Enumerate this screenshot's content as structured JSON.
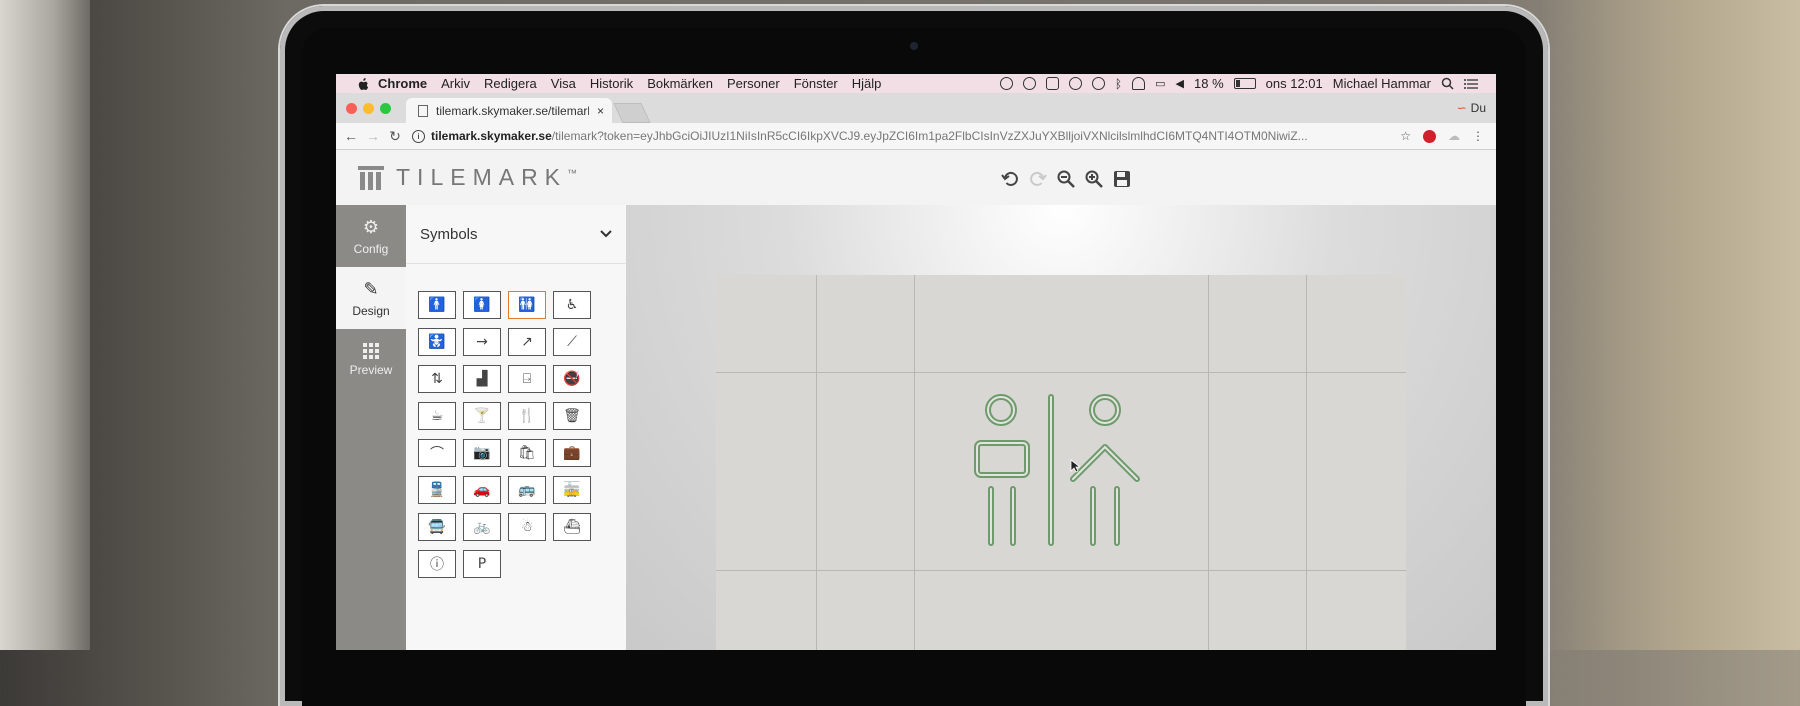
{
  "menubar": {
    "app": "Chrome",
    "items": [
      "Arkiv",
      "Redigera",
      "Visa",
      "Historik",
      "Bokmärken",
      "Personer",
      "Fönster",
      "Hjälp"
    ],
    "battery": "18 %",
    "clock": "ons 12:01",
    "user": "Michael Hammar"
  },
  "browser": {
    "tab_title": "tilemark.skymaker.se/tilemark",
    "tab_close": "×",
    "profile_label": "Du",
    "url_host": "tilemark.skymaker.se",
    "url_path": "/tilemark?token=eyJhbGciOiJIUzI1NiIsInR5cCI6IkpXVCJ9.eyJpZCI6Im1pa2FlbCIsInVzZXJuYXBlljoiVXNlcilslmlhdCI6MTQ4NTI4OTM0NiwiZ..."
  },
  "app": {
    "logo_text": "TILEMARK",
    "logo_tm": "™",
    "sidebar": {
      "tabs": [
        {
          "label": "Config",
          "icon": "gear-icon"
        },
        {
          "label": "Design",
          "icon": "pencil-icon"
        },
        {
          "label": "Preview",
          "icon": "grid-icon"
        }
      ],
      "active": "Design"
    },
    "panel": {
      "title": "Symbols",
      "symbols": [
        "man-icon",
        "woman-icon",
        "toilets-icon",
        "wheelchair-icon",
        "baby-change-icon",
        "arrow-right-icon",
        "arrow-diagonal-icon",
        "escalator-icon",
        "elevator-icon",
        "stairs-icon",
        "exit-icon",
        "no-smoking-icon",
        "coffee-icon",
        "cocktail-icon",
        "restaurant-icon",
        "trash-icon",
        "cloakroom-icon",
        "camera-icon",
        "shopping-icon",
        "luggage-icon",
        "train-icon",
        "car-icon",
        "bus-icon",
        "tram-icon",
        "coach-icon",
        "bicycle-icon",
        "lost-property-icon",
        "boat-icon",
        "info-icon",
        "parking-icon"
      ],
      "selected_index": 2
    },
    "toolbar": [
      "undo-icon",
      "redo-icon",
      "zoom-out-icon",
      "zoom-in-icon",
      "save-icon"
    ],
    "colors": {
      "symbol_stroke": "#6e9b6b",
      "selection": "#e07b2a",
      "sidebar": "#8c8a87"
    }
  }
}
